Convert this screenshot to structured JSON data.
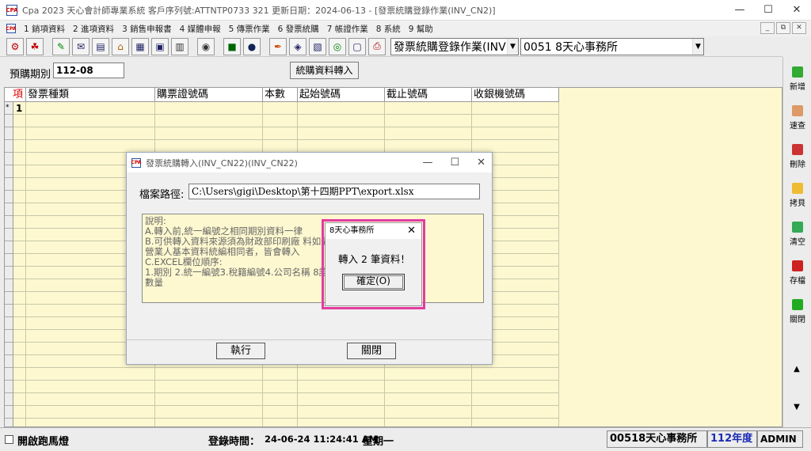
{
  "window": {
    "title": "Cpa 2023  天心會計師專業系統  客戶序列號:ATTNTP0733 321   更新日期：2024-06-13 - [發票統購登錄作業(INV_CN2)]",
    "icon_label": "CPA"
  },
  "menu": {
    "items": [
      "1 銷項資料",
      "2 進項資料",
      "3 銷售申報書",
      "4 媒體申報",
      "5 傳票作業",
      "6 發票統購",
      "7 帳證作業",
      "8 系統",
      "9 幫助"
    ]
  },
  "toolbar": {
    "form_select": "發票統購登錄作業(INV",
    "office_select": "0051  8天心事務所"
  },
  "period": {
    "label": "預購期別",
    "value": "112-08",
    "import_button": "統購資料轉入"
  },
  "grid": {
    "columns": [
      "項",
      "發票種類",
      "購票證號碼",
      "本數",
      "起始號碼",
      "截止號碼",
      "收銀機號碼"
    ],
    "row_marker": "*",
    "first_row_index": "1"
  },
  "right_panel": {
    "buttons": [
      "新增",
      "速查",
      "刪除",
      "拷貝",
      "清空",
      "存檔",
      "關閉"
    ]
  },
  "statusbar": {
    "marquee_label": "開啟跑馬燈",
    "login_label": "登錄時間：",
    "login_time": "24-06-24 11:24:41 AM",
    "weekday": "星期一",
    "office": "00518天心事務所",
    "year": "112年度",
    "user": "ADMIN"
  },
  "import_dialog": {
    "title": "發票統購轉入(INV_CN22)(INV_CN22)",
    "path_label": "檔案路徑:",
    "path_value": "C:\\Users\\gigi\\Desktop\\第十四期PPT\\export.xlsx",
    "description_lines": [
      "說明:",
      "A.轉入前,統一編號之相同期別資料一律",
      "B.可供轉入資料來源須為財政部印刷廠                    料如遇帳套",
      "營業人基本資料統編相同者，皆會轉入",
      "C.EXCEL欄位順序:",
      "1.期別 2.統一編號3.稅籍編號4.公司名稱                  8訖號9.購買",
      "數量"
    ],
    "execute_button": "執行",
    "close_button": "關閉"
  },
  "message_box": {
    "title": "8天心事務所",
    "text": "轉入 2 筆資料！",
    "ok_button": "確定(O)"
  },
  "colors": {
    "grid_background": "#fdf8d0",
    "highlight_border": "#e23ca0",
    "year_text": "#1b2bb5",
    "index_header": "#dd0000"
  }
}
